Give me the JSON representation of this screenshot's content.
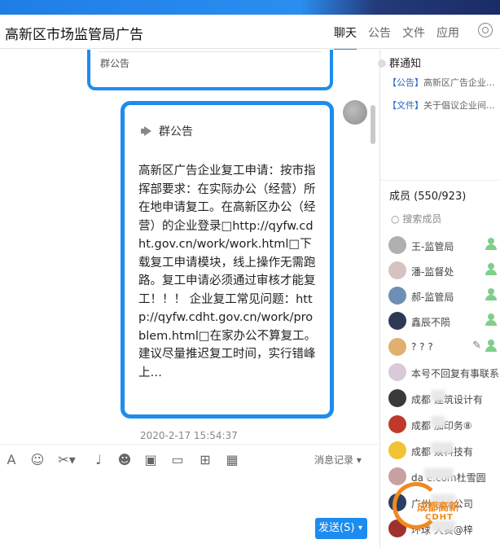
{
  "window": {
    "title": "高新区市场监管局广告"
  },
  "tabs": [
    {
      "label": "聊天",
      "active": true
    },
    {
      "label": "公告",
      "active": false
    },
    {
      "label": "文件",
      "active": false
    },
    {
      "label": "应用",
      "active": false
    }
  ],
  "chat": {
    "prev_bubble_label": "群公告",
    "bubble": {
      "header": "群公告",
      "body": "高新区广告企业复工申请：按市指挥部要求：在实际办公（经营）所在地申请复工。在高新区办公（经营）的企业登录□http://qyfw.cdht.gov.cn/work/work.html□下载复工申请模块，线上操作无需跑路。复工申请必须通过审核才能复工！！！ 企业复工常见问题：http://qyfw.cdht.gov.cn/work/problem.html□在家办公不算复工。建议尽量推迟复工时间，实行错峰上…"
    },
    "timestamp": "2020-2-17 15:54:37"
  },
  "toolbar": {
    "icons": [
      "font-icon",
      "emoji-icon",
      "scissors-icon",
      "microphone-icon",
      "sticker-icon",
      "image-icon",
      "folder-icon",
      "gift-icon",
      "calendar-icon"
    ],
    "history_label": "消息记录",
    "send_label": "发送(S)"
  },
  "sidebar": {
    "notice_title": "群通知",
    "notices": [
      {
        "tag": "【公告】",
        "text": "高新区广告企业..."
      },
      {
        "tag": "【文件】",
        "text": "关于倡议企业间..."
      }
    ],
    "members_title": "成员 (550/923)",
    "search_placeholder": "搜索成员",
    "members": [
      {
        "name": "王-监管局",
        "color": "#b0b0b0"
      },
      {
        "name": "潘-监督处",
        "color": "#d7c2c2"
      },
      {
        "name": "郝-监管局",
        "color": "#6d8fb3"
      },
      {
        "name": "鑫辰不陨",
        "color": "#2e3a55"
      },
      {
        "name": "? ? ?",
        "color": "#e0b070"
      },
      {
        "name": "本号不回复有事联系",
        "color": "#d9c9d9"
      },
      {
        "name": "成都   建筑设计有",
        "color": "#3a3a3a"
      },
      {
        "name": "成都   加印务⑧",
        "color": "#c0392b"
      },
      {
        "name": "成都     娱科技有",
        "color": "#f1c232"
      },
      {
        "name": "da      e.com杜雪圆",
        "color": "#c9a0a0"
      },
      {
        "name": "广州     装饰公司",
        "color": "#2b3f63"
      },
      {
        "name": "环球      大赛@梓",
        "color": "#a03030"
      }
    ]
  },
  "watermark": {
    "line1": "成都高新",
    "line2": "CDHT"
  }
}
